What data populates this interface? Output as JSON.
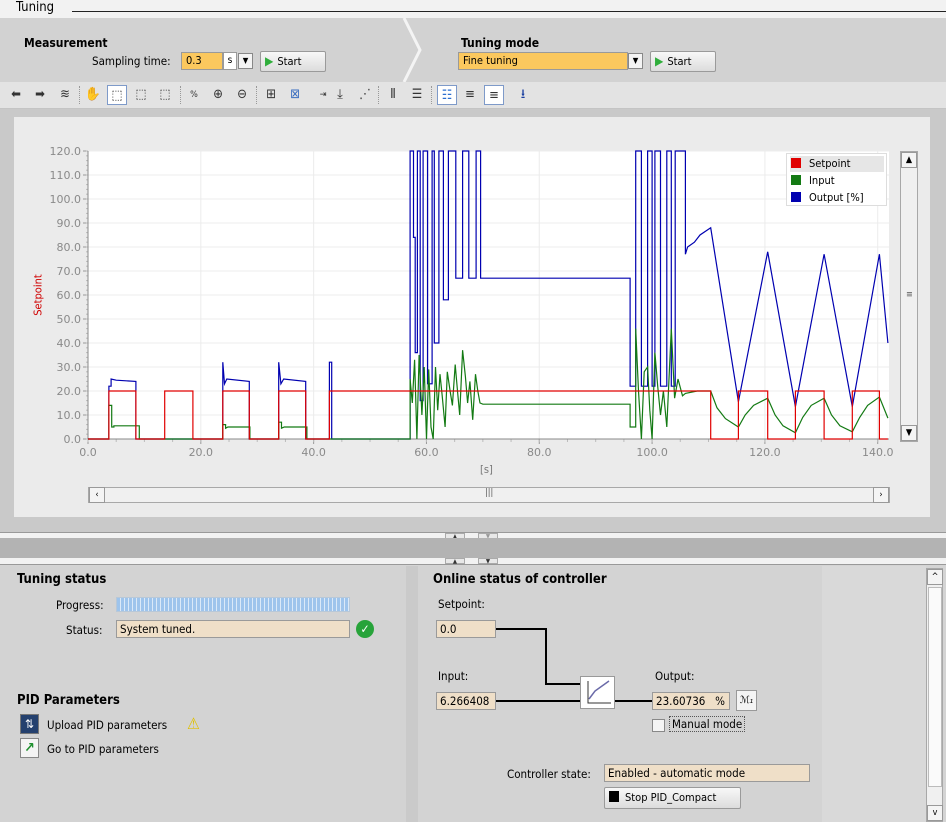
{
  "window": {
    "title": "Tuning"
  },
  "measurement": {
    "title": "Measurement",
    "sampling_label": "Sampling time:",
    "sampling_value": "0.3",
    "unit": "s",
    "start_label": "Start"
  },
  "tuning_mode": {
    "title": "Tuning mode",
    "value": "Fine tuning",
    "start_label": "Start"
  },
  "toolbar": {
    "icons": [
      "back-icon",
      "forward-icon",
      "chart-settings-icon",
      "pan-hand-icon",
      "zoom-area-icon",
      "zoom-vertical-icon",
      "zoom-horizontal-icon",
      "zoom-100-icon",
      "zoom-in-icon",
      "zoom-out-icon",
      "fit-vertical-icon",
      "fit-all-icon",
      "time-axis-icon",
      "measure-point-icon",
      "vertical-cursor-icon",
      "horizontal-cursor-icon",
      "legend-icon",
      "align-left-icon",
      "align-right-icon",
      "export-icon"
    ]
  },
  "colors": {
    "setpoint": "#e00000",
    "input": "#137a13",
    "output": "#0000b0",
    "accent_orange": "#fbc85e",
    "field_beige": "#efdfc8"
  },
  "chart_data": {
    "type": "line",
    "ylabel": "Setpoint",
    "xlabel": "[s]",
    "xlim": [
      0,
      142
    ],
    "ylim": [
      0,
      120
    ],
    "xticks": [
      "0.0",
      "20.0",
      "40.0",
      "60.0",
      "80.0",
      "100.0",
      "120.0",
      "140.0"
    ],
    "yticks": [
      "0.0",
      "10.0",
      "20.0",
      "30.0",
      "40.0",
      "50.0",
      "60.0",
      "70.0",
      "80.0",
      "90.0",
      "100.0",
      "110.0",
      "120.0"
    ],
    "grid": true,
    "legend_position": "top-right",
    "series": [
      {
        "name": "Setpoint",
        "color": "#e00000",
        "points": [
          [
            0,
            0
          ],
          [
            3.7,
            0
          ],
          [
            3.7,
            20
          ],
          [
            8.5,
            20
          ],
          [
            8.5,
            0
          ],
          [
            13.6,
            0
          ],
          [
            13.6,
            20
          ],
          [
            18.6,
            20
          ],
          [
            18.6,
            0
          ],
          [
            23.9,
            0
          ],
          [
            23.9,
            20
          ],
          [
            28.6,
            20
          ],
          [
            28.6,
            0
          ],
          [
            33.8,
            0
          ],
          [
            33.8,
            20
          ],
          [
            38.6,
            20
          ],
          [
            38.6,
            0
          ],
          [
            42.8,
            0
          ],
          [
            42.8,
            20
          ],
          [
            110.4,
            20
          ],
          [
            110.4,
            0
          ],
          [
            115.3,
            0
          ],
          [
            115.3,
            20
          ],
          [
            120.5,
            20
          ],
          [
            120.5,
            0
          ],
          [
            125.4,
            0
          ],
          [
            125.4,
            20
          ],
          [
            130.5,
            20
          ],
          [
            130.5,
            0
          ],
          [
            135.5,
            0
          ],
          [
            135.5,
            20
          ],
          [
            140.3,
            20
          ],
          [
            140.3,
            0
          ],
          [
            141.8,
            0
          ]
        ]
      },
      {
        "name": "Input",
        "color": "#137a13",
        "points": [
          [
            0,
            0
          ],
          [
            3.7,
            0
          ],
          [
            3.7,
            14
          ],
          [
            4.2,
            14
          ],
          [
            4.2,
            5
          ],
          [
            4.6,
            5
          ],
          [
            4.6,
            5.5
          ],
          [
            9.1,
            5.5
          ],
          [
            9.1,
            0
          ],
          [
            23.9,
            0
          ],
          [
            23.9,
            6
          ],
          [
            24.4,
            6
          ],
          [
            24.4,
            4.5
          ],
          [
            24.8,
            5
          ],
          [
            28.7,
            5
          ],
          [
            28.7,
            0
          ],
          [
            33.8,
            0
          ],
          [
            33.8,
            7
          ],
          [
            34.3,
            7
          ],
          [
            34.3,
            4.5
          ],
          [
            34.8,
            5
          ],
          [
            38.8,
            5
          ],
          [
            38.8,
            0
          ],
          [
            57.1,
            0
          ],
          [
            57.1,
            25
          ],
          [
            57.5,
            15
          ],
          [
            57.9,
            33
          ],
          [
            58.3,
            0
          ],
          [
            58.7,
            35
          ],
          [
            59.2,
            10
          ],
          [
            59.6,
            30
          ],
          [
            60.0,
            0
          ],
          [
            60.4,
            29
          ],
          [
            60.8,
            5
          ],
          [
            61.2,
            0
          ],
          [
            61.6,
            30
          ],
          [
            62.0,
            12
          ],
          [
            62.4,
            27
          ],
          [
            62.8,
            18
          ],
          [
            63.3,
            5
          ],
          [
            63.7,
            28
          ],
          [
            64.2,
            20
          ],
          [
            64.6,
            14
          ],
          [
            65.1,
            31
          ],
          [
            65.5,
            20
          ],
          [
            65.9,
            10
          ],
          [
            66.4,
            37
          ],
          [
            66.9,
            26
          ],
          [
            67.3,
            15
          ],
          [
            67.7,
            24
          ],
          [
            68.2,
            8
          ],
          [
            68.7,
            27
          ],
          [
            69.1,
            20
          ],
          [
            69.5,
            15
          ],
          [
            70,
            14.5
          ],
          [
            96.1,
            14.5
          ],
          [
            96.1,
            5
          ],
          [
            97.1,
            5
          ],
          [
            97.1,
            46
          ],
          [
            97.6,
            20
          ],
          [
            98.1,
            0
          ],
          [
            98.6,
            28
          ],
          [
            99.2,
            30
          ],
          [
            99.6,
            12
          ],
          [
            100.0,
            0
          ],
          [
            100.5,
            36
          ],
          [
            101.0,
            22
          ],
          [
            101.5,
            10
          ],
          [
            102.0,
            20
          ],
          [
            102.6,
            5
          ],
          [
            103.4,
            46
          ],
          [
            104.0,
            17
          ],
          [
            104.6,
            25
          ],
          [
            105.4,
            18
          ],
          [
            105.9,
            19
          ],
          [
            108,
            20
          ],
          [
            110.4,
            20
          ],
          [
            111.5,
            13
          ],
          [
            113,
            8.5
          ],
          [
            115.3,
            5
          ],
          [
            116.5,
            10
          ],
          [
            118,
            14
          ],
          [
            120.5,
            17
          ],
          [
            121.8,
            10
          ],
          [
            123.2,
            5.5
          ],
          [
            125.4,
            2.6
          ],
          [
            126.7,
            9
          ],
          [
            128.2,
            14
          ],
          [
            130.5,
            17
          ],
          [
            131.8,
            10
          ],
          [
            133.3,
            5.5
          ],
          [
            135.5,
            3
          ],
          [
            136.8,
            9
          ],
          [
            138.2,
            14
          ],
          [
            140.3,
            17.5
          ],
          [
            141.8,
            8.7
          ]
        ]
      },
      {
        "name": "Output [%]",
        "color": "#0000b0",
        "points": [
          [
            0,
            0
          ],
          [
            3.7,
            0
          ],
          [
            3.7,
            22
          ],
          [
            4.1,
            22
          ],
          [
            4.1,
            25
          ],
          [
            5,
            24.5
          ],
          [
            8.5,
            24
          ],
          [
            8.5,
            0
          ],
          [
            23.9,
            0
          ],
          [
            23.9,
            32
          ],
          [
            24.2,
            23
          ],
          [
            24.6,
            25
          ],
          [
            28.6,
            24
          ],
          [
            28.6,
            0
          ],
          [
            33.8,
            0
          ],
          [
            33.8,
            32
          ],
          [
            34.2,
            23
          ],
          [
            34.7,
            25
          ],
          [
            38.6,
            24
          ],
          [
            38.6,
            0
          ],
          [
            42.8,
            0
          ],
          [
            42.8,
            32
          ],
          [
            43.2,
            32
          ],
          [
            43.2,
            0
          ],
          [
            57.1,
            0
          ],
          [
            57.1,
            120
          ],
          [
            57.7,
            120
          ],
          [
            57.7,
            84
          ],
          [
            58.0,
            84
          ],
          [
            58.0,
            36
          ],
          [
            58.4,
            36
          ],
          [
            58.4,
            120
          ],
          [
            58.9,
            120
          ],
          [
            58.9,
            16
          ],
          [
            59.4,
            16
          ],
          [
            59.4,
            120
          ],
          [
            60.2,
            120
          ],
          [
            60.2,
            23
          ],
          [
            61.0,
            23
          ],
          [
            61.0,
            120
          ],
          [
            61.4,
            120
          ],
          [
            61.4,
            40
          ],
          [
            62.2,
            40
          ],
          [
            62.2,
            120
          ],
          [
            63.0,
            120
          ],
          [
            63.0,
            58
          ],
          [
            63.9,
            58
          ],
          [
            63.9,
            120
          ],
          [
            65.2,
            120
          ],
          [
            65.2,
            67
          ],
          [
            66.4,
            67
          ],
          [
            66.4,
            120
          ],
          [
            67.5,
            120
          ],
          [
            67.5,
            67
          ],
          [
            68.8,
            67
          ],
          [
            68.8,
            120
          ],
          [
            69.6,
            120
          ],
          [
            69.6,
            67
          ],
          [
            96.1,
            67
          ],
          [
            96.1,
            22
          ],
          [
            97.1,
            22
          ],
          [
            97.1,
            120
          ],
          [
            98.1,
            120
          ],
          [
            98.1,
            22
          ],
          [
            99.2,
            22
          ],
          [
            99.2,
            120
          ],
          [
            100.0,
            120
          ],
          [
            100.0,
            22
          ],
          [
            100.5,
            22
          ],
          [
            100.5,
            120
          ],
          [
            101.5,
            120
          ],
          [
            101.5,
            22
          ],
          [
            102.6,
            22
          ],
          [
            102.6,
            120
          ],
          [
            103.4,
            120
          ],
          [
            103.4,
            22
          ],
          [
            104.1,
            22
          ],
          [
            104.1,
            120
          ],
          [
            105.9,
            120
          ],
          [
            105.9,
            77
          ],
          [
            106.3,
            80
          ],
          [
            107.5,
            82
          ],
          [
            108.5,
            85
          ],
          [
            110.4,
            88
          ],
          [
            115.3,
            15.5
          ],
          [
            120.5,
            78
          ],
          [
            125.4,
            13.5
          ],
          [
            130.5,
            77
          ],
          [
            135.5,
            13.5
          ],
          [
            140.3,
            77
          ],
          [
            141.8,
            40
          ]
        ]
      }
    ]
  },
  "tuning_status": {
    "title": "Tuning status",
    "progress_label": "Progress:",
    "progress": 1.0,
    "status_label": "Status:",
    "status_value": "System tuned."
  },
  "pid_parameters": {
    "title": "PID Parameters",
    "upload_label": "Upload PID parameters",
    "goto_label": "Go to PID parameters"
  },
  "online_status": {
    "title": "Online status of controller",
    "setpoint_label": "Setpoint:",
    "setpoint_value": "0.0",
    "input_label": "Input:",
    "input_value": "6.266408",
    "output_label": "Output:",
    "output_value": "23.60736",
    "output_unit": "%",
    "manual_mode_label": "Manual mode",
    "manual_mode_checked": false,
    "controller_state_label": "Controller state:",
    "controller_state_value": "Enabled - automatic mode",
    "stop_label": "Stop PID_Compact"
  }
}
